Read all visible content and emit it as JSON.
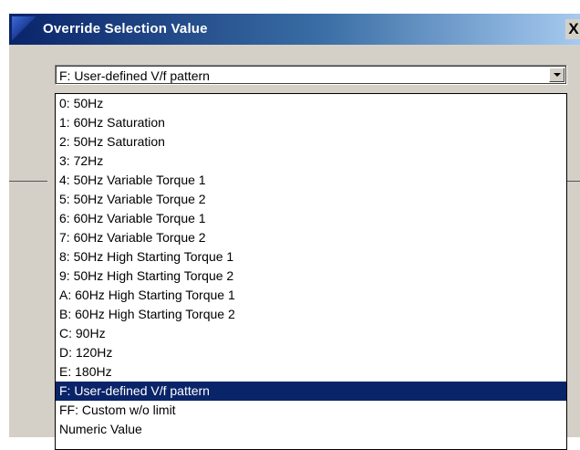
{
  "window": {
    "title": "Override Selection Value",
    "close_label": "X"
  },
  "combo": {
    "value": "F: User-defined V/f pattern"
  },
  "dropdown": {
    "options": [
      "0: 50Hz",
      "1: 60Hz Saturation",
      "2: 50Hz Saturation",
      "3: 72Hz",
      "4: 50Hz Variable Torque 1",
      "5: 50Hz Variable Torque 2",
      "6: 60Hz Variable Torque 1",
      "7: 60Hz Variable Torque 2",
      "8: 50Hz High Starting Torque 1",
      "9: 50Hz High Starting Torque 2",
      "A: 60Hz High Starting Torque 1",
      "B: 60Hz High Starting Torque 2",
      "C: 90Hz",
      "D: 120Hz",
      "E: 180Hz",
      "F: User-defined V/f pattern",
      "FF: Custom w/o limit",
      "Numeric Value"
    ],
    "selected_index": 15
  },
  "colors": {
    "selection_bg": "#0a246a",
    "title_start": "#0a246a",
    "title_end": "#a6caf0",
    "dialog_bg": "#d4d0c8"
  }
}
